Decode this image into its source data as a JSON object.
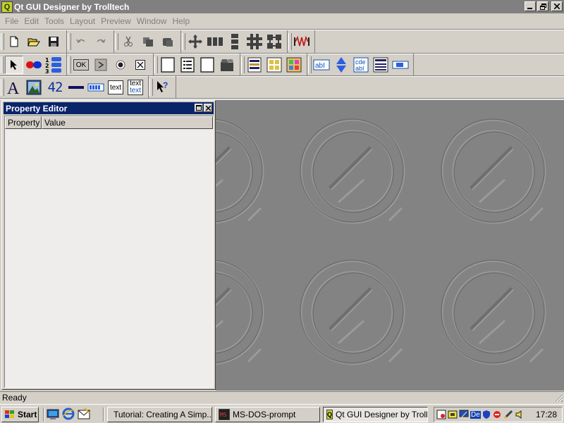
{
  "window": {
    "title": "Qt GUI Designer by Trolltech",
    "app_icon_glyph": "Q"
  },
  "menu": [
    "File",
    "Edit",
    "Tools",
    "Layout",
    "Preview",
    "Window",
    "Help"
  ],
  "property_editor": {
    "title": "Property Editor",
    "columns": [
      "Property",
      "Value"
    ]
  },
  "status": {
    "text": "Ready"
  },
  "taskbar": {
    "start_label": "Start",
    "tasks": [
      {
        "label": "Tutorial: Creating A Simp..."
      },
      {
        "label": "MS-DOS-prompt"
      },
      {
        "label": "Qt GUI Designer by Troll..."
      }
    ],
    "tray_label": "De",
    "clock": "17:28"
  },
  "widget_box": {
    "ok_button_label": "OK",
    "text_label_1": "text",
    "text_label_2": "text",
    "text_label_3": "text",
    "lcd_label": "42"
  },
  "colors": {
    "active_title": "#0a246a",
    "inactive_title": "#808080",
    "face": "#d4d0c8",
    "workspace": "#838383"
  }
}
